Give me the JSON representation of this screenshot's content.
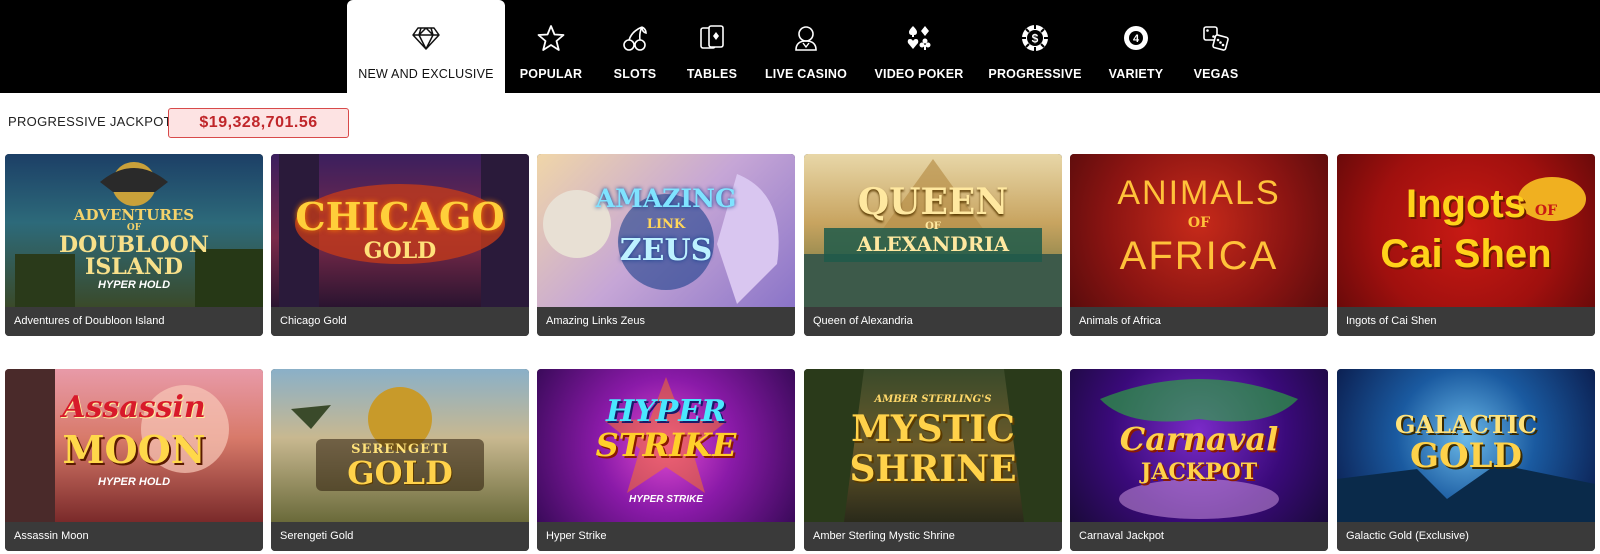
{
  "nav": {
    "tabs": [
      {
        "label": "NEW AND EXCLUSIVE",
        "icon": "diamond-icon",
        "active": true
      },
      {
        "label": "POPULAR",
        "icon": "star-icon"
      },
      {
        "label": "SLOTS",
        "icon": "cherries-icon"
      },
      {
        "label": "TABLES",
        "icon": "cards-icon"
      },
      {
        "label": "LIVE CASINO",
        "icon": "dealer-icon"
      },
      {
        "label": "VIDEO POKER",
        "icon": "card-suits-icon"
      },
      {
        "label": "PROGRESSIVE",
        "icon": "chip-icon"
      },
      {
        "label": "VARIETY",
        "icon": "ball-icon"
      },
      {
        "label": "VEGAS",
        "icon": "dice-icon"
      }
    ]
  },
  "jackpot": {
    "label": "PROGRESSIVE JACKPOT",
    "value": "$19,328,701.56"
  },
  "games": [
    {
      "name": "Adventures of Doubloon Island",
      "art_lines": [
        "ADVENTURES",
        "OF",
        "DOUBLOON",
        "ISLAND",
        "HYPER HOLD"
      ]
    },
    {
      "name": "Chicago Gold",
      "art_lines": [
        "CHICAGO",
        "GOLD"
      ]
    },
    {
      "name": "Amazing Links Zeus",
      "art_lines": [
        "AMAZING",
        "LINK",
        "ZEUS"
      ]
    },
    {
      "name": "Queen of Alexandria",
      "art_lines": [
        "QUEEN",
        "OF",
        "ALEXANDRIA"
      ]
    },
    {
      "name": "Animals of Africa",
      "art_lines": [
        "ANIMALS",
        "OF",
        "AFRICA"
      ]
    },
    {
      "name": "Ingots of Cai Shen",
      "art_lines": [
        "Ingots",
        "OF",
        "Cai Shen"
      ]
    },
    {
      "name": "Assassin Moon",
      "art_lines": [
        "Assassin",
        "MOON",
        "HYPER HOLD"
      ]
    },
    {
      "name": "Serengeti Gold",
      "art_lines": [
        "SERENGETI",
        "GOLD"
      ]
    },
    {
      "name": "Hyper Strike",
      "art_lines": [
        "HYPER",
        "STRIKE",
        "HYPER STRIKE"
      ]
    },
    {
      "name": "Amber Sterling Mystic Shrine",
      "art_lines": [
        "AMBER STERLING'S",
        "MYSTIC",
        "SHRINE"
      ]
    },
    {
      "name": "Carnaval Jackpot",
      "art_lines": [
        "Carnaval",
        "JACKPOT"
      ]
    },
    {
      "name": "Galactic Gold (Exclusive)",
      "art_lines": [
        "GALACTIC",
        "GOLD"
      ]
    }
  ]
}
